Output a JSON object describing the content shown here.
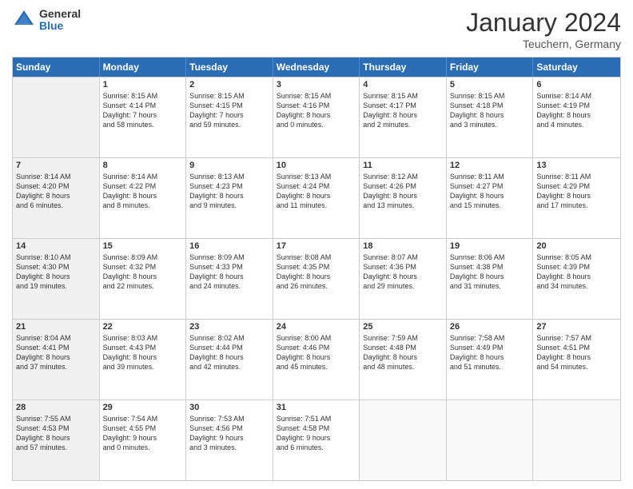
{
  "header": {
    "logo_general": "General",
    "logo_blue": "Blue",
    "month_title": "January 2024",
    "location": "Teuchern, Germany"
  },
  "weekdays": [
    "Sunday",
    "Monday",
    "Tuesday",
    "Wednesday",
    "Thursday",
    "Friday",
    "Saturday"
  ],
  "rows": [
    [
      {
        "day": "",
        "info": "",
        "shaded": true
      },
      {
        "day": "1",
        "info": "Sunrise: 8:15 AM\nSunset: 4:14 PM\nDaylight: 7 hours\nand 58 minutes.",
        "shaded": false
      },
      {
        "day": "2",
        "info": "Sunrise: 8:15 AM\nSunset: 4:15 PM\nDaylight: 7 hours\nand 59 minutes.",
        "shaded": false
      },
      {
        "day": "3",
        "info": "Sunrise: 8:15 AM\nSunset: 4:16 PM\nDaylight: 8 hours\nand 0 minutes.",
        "shaded": false
      },
      {
        "day": "4",
        "info": "Sunrise: 8:15 AM\nSunset: 4:17 PM\nDaylight: 8 hours\nand 2 minutes.",
        "shaded": false
      },
      {
        "day": "5",
        "info": "Sunrise: 8:15 AM\nSunset: 4:18 PM\nDaylight: 8 hours\nand 3 minutes.",
        "shaded": false
      },
      {
        "day": "6",
        "info": "Sunrise: 8:14 AM\nSunset: 4:19 PM\nDaylight: 8 hours\nand 4 minutes.",
        "shaded": false
      }
    ],
    [
      {
        "day": "7",
        "info": "Sunrise: 8:14 AM\nSunset: 4:20 PM\nDaylight: 8 hours\nand 6 minutes.",
        "shaded": true
      },
      {
        "day": "8",
        "info": "Sunrise: 8:14 AM\nSunset: 4:22 PM\nDaylight: 8 hours\nand 8 minutes.",
        "shaded": false
      },
      {
        "day": "9",
        "info": "Sunrise: 8:13 AM\nSunset: 4:23 PM\nDaylight: 8 hours\nand 9 minutes.",
        "shaded": false
      },
      {
        "day": "10",
        "info": "Sunrise: 8:13 AM\nSunset: 4:24 PM\nDaylight: 8 hours\nand 11 minutes.",
        "shaded": false
      },
      {
        "day": "11",
        "info": "Sunrise: 8:12 AM\nSunset: 4:26 PM\nDaylight: 8 hours\nand 13 minutes.",
        "shaded": false
      },
      {
        "day": "12",
        "info": "Sunrise: 8:11 AM\nSunset: 4:27 PM\nDaylight: 8 hours\nand 15 minutes.",
        "shaded": false
      },
      {
        "day": "13",
        "info": "Sunrise: 8:11 AM\nSunset: 4:29 PM\nDaylight: 8 hours\nand 17 minutes.",
        "shaded": false
      }
    ],
    [
      {
        "day": "14",
        "info": "Sunrise: 8:10 AM\nSunset: 4:30 PM\nDaylight: 8 hours\nand 19 minutes.",
        "shaded": true
      },
      {
        "day": "15",
        "info": "Sunrise: 8:09 AM\nSunset: 4:32 PM\nDaylight: 8 hours\nand 22 minutes.",
        "shaded": false
      },
      {
        "day": "16",
        "info": "Sunrise: 8:09 AM\nSunset: 4:33 PM\nDaylight: 8 hours\nand 24 minutes.",
        "shaded": false
      },
      {
        "day": "17",
        "info": "Sunrise: 8:08 AM\nSunset: 4:35 PM\nDaylight: 8 hours\nand 26 minutes.",
        "shaded": false
      },
      {
        "day": "18",
        "info": "Sunrise: 8:07 AM\nSunset: 4:36 PM\nDaylight: 8 hours\nand 29 minutes.",
        "shaded": false
      },
      {
        "day": "19",
        "info": "Sunrise: 8:06 AM\nSunset: 4:38 PM\nDaylight: 8 hours\nand 31 minutes.",
        "shaded": false
      },
      {
        "day": "20",
        "info": "Sunrise: 8:05 AM\nSunset: 4:39 PM\nDaylight: 8 hours\nand 34 minutes.",
        "shaded": false
      }
    ],
    [
      {
        "day": "21",
        "info": "Sunrise: 8:04 AM\nSunset: 4:41 PM\nDaylight: 8 hours\nand 37 minutes.",
        "shaded": true
      },
      {
        "day": "22",
        "info": "Sunrise: 8:03 AM\nSunset: 4:43 PM\nDaylight: 8 hours\nand 39 minutes.",
        "shaded": false
      },
      {
        "day": "23",
        "info": "Sunrise: 8:02 AM\nSunset: 4:44 PM\nDaylight: 8 hours\nand 42 minutes.",
        "shaded": false
      },
      {
        "day": "24",
        "info": "Sunrise: 8:00 AM\nSunset: 4:46 PM\nDaylight: 8 hours\nand 45 minutes.",
        "shaded": false
      },
      {
        "day": "25",
        "info": "Sunrise: 7:59 AM\nSunset: 4:48 PM\nDaylight: 8 hours\nand 48 minutes.",
        "shaded": false
      },
      {
        "day": "26",
        "info": "Sunrise: 7:58 AM\nSunset: 4:49 PM\nDaylight: 8 hours\nand 51 minutes.",
        "shaded": false
      },
      {
        "day": "27",
        "info": "Sunrise: 7:57 AM\nSunset: 4:51 PM\nDaylight: 8 hours\nand 54 minutes.",
        "shaded": false
      }
    ],
    [
      {
        "day": "28",
        "info": "Sunrise: 7:55 AM\nSunset: 4:53 PM\nDaylight: 8 hours\nand 57 minutes.",
        "shaded": true
      },
      {
        "day": "29",
        "info": "Sunrise: 7:54 AM\nSunset: 4:55 PM\nDaylight: 9 hours\nand 0 minutes.",
        "shaded": false
      },
      {
        "day": "30",
        "info": "Sunrise: 7:53 AM\nSunset: 4:56 PM\nDaylight: 9 hours\nand 3 minutes.",
        "shaded": false
      },
      {
        "day": "31",
        "info": "Sunrise: 7:51 AM\nSunset: 4:58 PM\nDaylight: 9 hours\nand 6 minutes.",
        "shaded": false
      },
      {
        "day": "",
        "info": "",
        "shaded": false
      },
      {
        "day": "",
        "info": "",
        "shaded": false
      },
      {
        "day": "",
        "info": "",
        "shaded": false
      }
    ]
  ]
}
